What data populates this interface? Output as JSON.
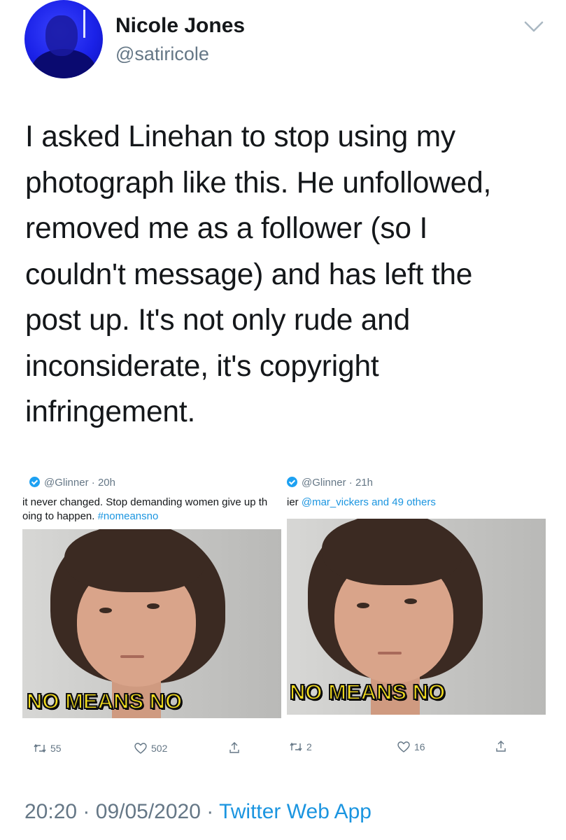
{
  "author": {
    "name": "Nicole Jones",
    "handle": "@satiricole"
  },
  "tweet": {
    "lines": [
      "I asked Linehan to stop using my",
      "photograph like this. He unfollowed,",
      "removed me as a follower (so I",
      "couldn't message) and has left the",
      "post up. It's not only rude and",
      "inconsiderate, it's copyright",
      "infringement."
    ]
  },
  "embeds": [
    {
      "handle": "@Glinner",
      "time": "20h",
      "snippet_line1": "it never changed. Stop demanding women give up th",
      "snippet_line2": "oing to happen. ",
      "hashtag": "#nomeansno",
      "caption": "NO MEANS NO",
      "retweets": "55",
      "likes": "502"
    },
    {
      "handle": "@Glinner",
      "time": "21h",
      "snippet_line1": "ier ",
      "mention": "@mar_vickers and 49 others",
      "caption": "NO MEANS NO",
      "retweets": "2",
      "likes": "16"
    }
  ],
  "footer": {
    "time": "20:20",
    "date": "09/05/2020",
    "separator": "·",
    "app": "Twitter Web App"
  },
  "colors": {
    "link": "#1b95e0",
    "muted": "#657786",
    "caption": "#f7e01e"
  },
  "icons": [
    "chevron-down-icon",
    "verified-icon",
    "retweet-icon",
    "like-icon",
    "share-icon"
  ]
}
